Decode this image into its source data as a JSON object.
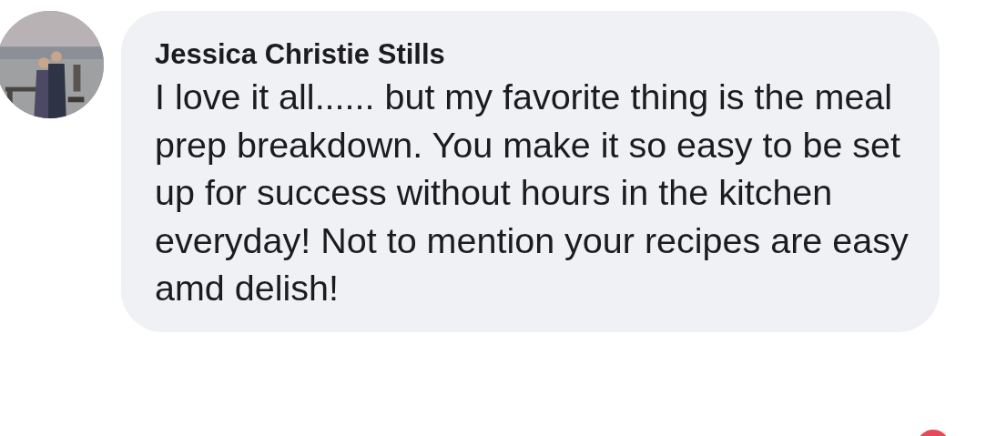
{
  "comment": {
    "author": "Jessica Christie Stills",
    "text": "I love it all...... but my favorite thing is the meal prep breakdown. You make it so easy to be set up for success without hours in the kitchen everyday! Not to mention your recipes are easy amd delish!"
  }
}
